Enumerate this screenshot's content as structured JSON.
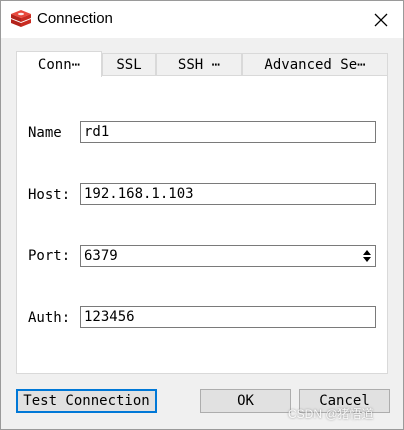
{
  "window": {
    "title": "Connection"
  },
  "tabs": [
    {
      "label": "Conn⋯",
      "active": true
    },
    {
      "label": "SSL",
      "active": false
    },
    {
      "label": "SSH ⋯",
      "active": false
    },
    {
      "label": "Advanced Se⋯",
      "active": false
    }
  ],
  "form": {
    "name": {
      "label": "Name",
      "value": "rd1"
    },
    "host": {
      "label": "Host:",
      "value": "192.168.1.103"
    },
    "port": {
      "label": "Port:",
      "value": "6379"
    },
    "auth": {
      "label": "Auth:",
      "value": "123456"
    }
  },
  "buttons": {
    "test": "Test Connection",
    "ok": "OK",
    "cancel": "Cancel"
  },
  "watermark": "CSDN @猪悟道",
  "colors": {
    "accent": "#0078d7",
    "icon_red": "#d92b23"
  }
}
